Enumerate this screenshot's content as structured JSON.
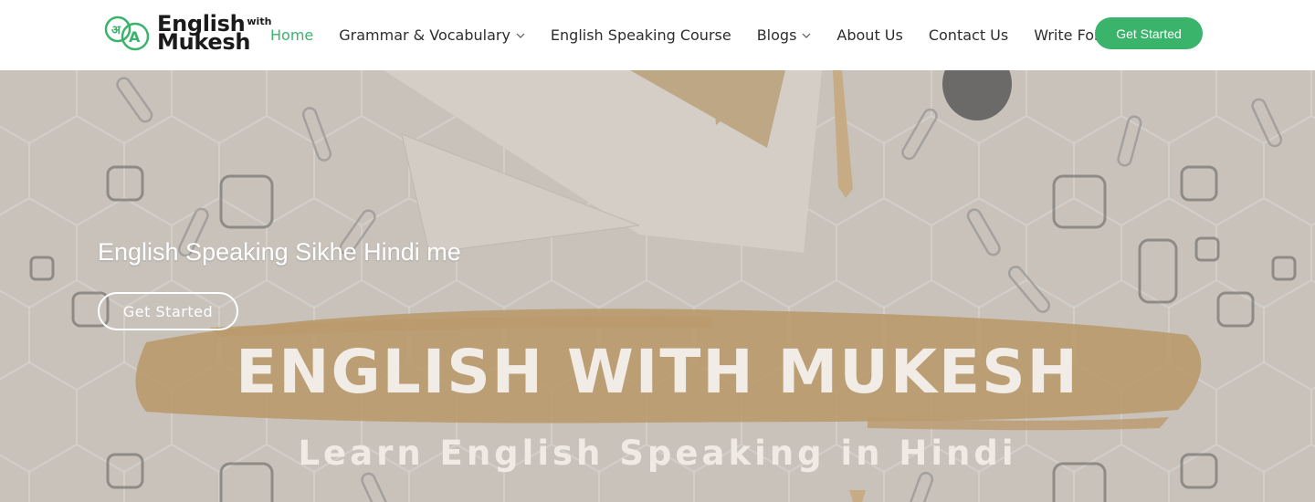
{
  "logo": {
    "word1": "English",
    "with": "with",
    "word2": "Mukesh",
    "icon_letters": "अA"
  },
  "nav": {
    "items": [
      {
        "label": "Home"
      },
      {
        "label": "Grammar & Vocabulary"
      },
      {
        "label": "English Speaking Course"
      },
      {
        "label": "Blogs"
      },
      {
        "label": "About Us"
      },
      {
        "label": "Contact Us"
      },
      {
        "label": "Write For Us"
      }
    ],
    "cta": "Get Started"
  },
  "hero": {
    "headline": "English Speaking Sikhe Hindi me",
    "button": "Get Started",
    "banner_title": "ENGLISH WITH MUKESH",
    "banner_subtitle": "Learn English Speaking in Hindi"
  },
  "colors": {
    "accent": "#3ab36b",
    "nav_text": "#2d2d2d",
    "brush": "#c9a46f"
  }
}
